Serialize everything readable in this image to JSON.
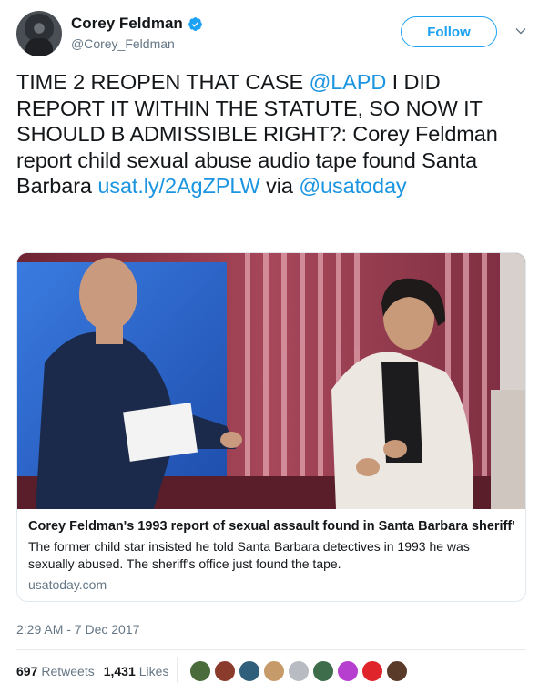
{
  "author": {
    "display_name": "Corey Feldman",
    "handle": "@Corey_Feldman",
    "verified_icon": "verified-badge-icon",
    "avatar_icon": "profile-photo"
  },
  "actions": {
    "follow_label": "Follow",
    "menu_icon": "chevron-down-icon"
  },
  "tweet": {
    "text_1": "TIME 2 REOPEN THAT CASE ",
    "mention_1": "@LAPD",
    "text_2": " I DID REPORT IT WITHIN THE STATUTE, SO NOW IT SHOULD B ADMISSIBLE RIGHT?: Corey Feldman report child sexual abuse audio tape found Santa Barbara ",
    "link": "usat.ly/2AgZPLW",
    "text_3": " via ",
    "mention_2": "@usatoday"
  },
  "card": {
    "image_alt": "two men seated in a TV studio interview",
    "title": "Corey Feldman's 1993 report of sexual assault found in Santa Barbara sheriff'...",
    "description": "The former child star insisted he told Santa Barbara detectives in 1993 he was sexually abused. The sheriff's office just found the tape.",
    "domain": "usatoday.com"
  },
  "meta": {
    "timestamp": "2:29 AM - 7 Dec 2017"
  },
  "stats": {
    "retweets_count": "697",
    "retweets_label": "Retweets",
    "likes_count": "1,431",
    "likes_label": "Likes"
  },
  "colors": {
    "link": "#1b95e0",
    "follow_accent": "#1da1f2",
    "secondary_text": "#657786"
  },
  "likers": [
    {
      "color": "#4a6b3a"
    },
    {
      "color": "#8a3b2c"
    },
    {
      "color": "#2f5f7a"
    },
    {
      "color": "#c79a6a"
    },
    {
      "color": "#b8bcc2"
    },
    {
      "color": "#3d6d4a"
    },
    {
      "color": "#b73fd0"
    },
    {
      "color": "#e0242c"
    },
    {
      "color": "#5a3a28"
    }
  ]
}
